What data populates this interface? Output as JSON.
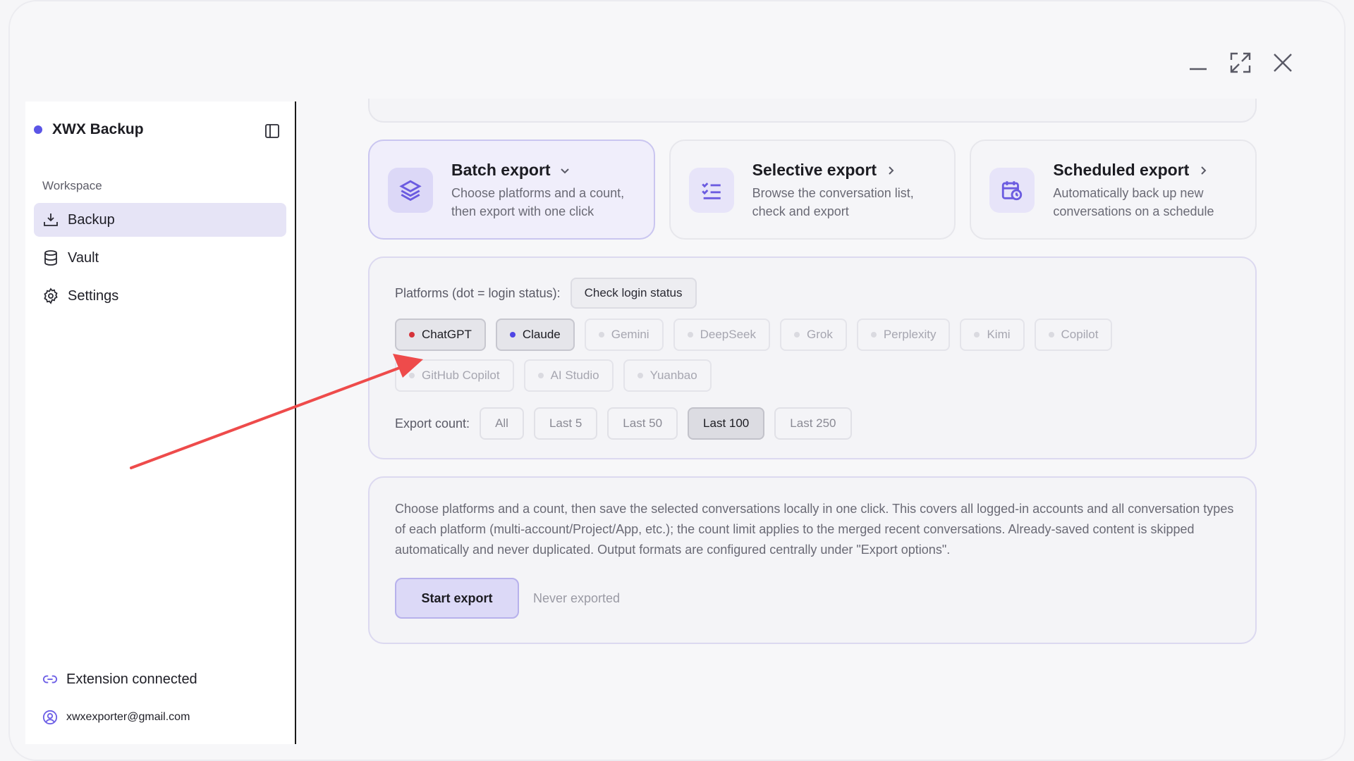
{
  "window": {
    "controls": {
      "minimize": "minimize-icon",
      "maximize": "maximize-icon",
      "close": "close-icon"
    }
  },
  "sidebar": {
    "brand": "XWX Backup",
    "section_label": "Workspace",
    "items": [
      {
        "label": "Backup",
        "icon": "backup-icon",
        "active": true
      },
      {
        "label": "Vault",
        "icon": "database-icon",
        "active": false
      },
      {
        "label": "Settings",
        "icon": "gear-icon",
        "active": false
      }
    ],
    "footer": {
      "extension_status": "Extension connected",
      "account_email": "xwxexporter@gmail.com"
    }
  },
  "cards": [
    {
      "title": "Batch export",
      "desc1": "Choose platforms and a count,",
      "desc2": "then export with one click",
      "icon": "layers-icon",
      "chevron": "chevron-down-icon",
      "active": true
    },
    {
      "title": "Selective export",
      "desc1": "Browse the conversation list,",
      "desc2": "check and export",
      "icon": "checklist-icon",
      "chevron": "chevron-right-icon",
      "active": false
    },
    {
      "title": "Scheduled export",
      "desc1": "Automatically back up new",
      "desc2": "conversations on a schedule",
      "icon": "calendar-clock-icon",
      "chevron": "chevron-right-icon",
      "active": false
    }
  ],
  "platforms": {
    "label": "Platforms (dot = login status):",
    "check_button": "Check login status",
    "items": [
      {
        "name": "ChatGPT",
        "selected": true,
        "dot": "#d6333a"
      },
      {
        "name": "Claude",
        "selected": true,
        "dot": "#4f46e5"
      },
      {
        "name": "Gemini",
        "selected": false
      },
      {
        "name": "DeepSeek",
        "selected": false
      },
      {
        "name": "Grok",
        "selected": false
      },
      {
        "name": "Perplexity",
        "selected": false
      },
      {
        "name": "Kimi",
        "selected": false
      },
      {
        "name": "Copilot",
        "selected": false
      },
      {
        "name": "GitHub Copilot",
        "selected": false
      },
      {
        "name": "AI Studio",
        "selected": false
      },
      {
        "name": "Yuanbao",
        "selected": false
      }
    ]
  },
  "export_count": {
    "label": "Export count:",
    "options": [
      "All",
      "Last 5",
      "Last 50",
      "Last 100",
      "Last 250"
    ],
    "selected": "Last 100"
  },
  "info": {
    "description": "Choose platforms and a count, then save the selected conversations locally in one click. This covers all logged-in accounts and all conversation types of each platform (multi-account/Project/App, etc.); the count limit applies to the merged recent conversations. Already-saved content is skipped automatically and never duplicated. Output formats are configured centrally under \"Export options\".",
    "start_button": "Start export",
    "status": "Never exported"
  },
  "colors": {
    "accent": "#5b55e6",
    "annotation_arrow": "#ee4b4b"
  }
}
